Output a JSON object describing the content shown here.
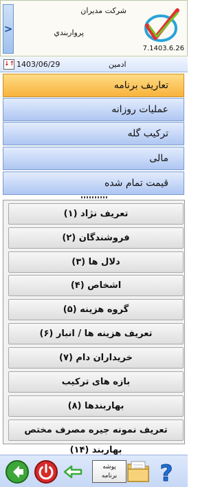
{
  "header": {
    "company": "شرکت مدیران",
    "product": "پرواربندي",
    "version": "7.1403.6.26",
    "back_glyph": ">"
  },
  "userbar": {
    "date": "1403/06/29",
    "user": "ادمین",
    "toggle_glyph": "↓↑"
  },
  "categories": [
    {
      "label": "تعاریف برنامه"
    },
    {
      "label": "عملیات روزانه"
    },
    {
      "label": "ترکیب گله"
    },
    {
      "label": "مالی"
    },
    {
      "label": "قیمت تمام شده"
    }
  ],
  "sub_items": [
    {
      "label": "تعریف نژاد (۱)"
    },
    {
      "label": "فروشندگان (۲)"
    },
    {
      "label": "دلال ها (۳)"
    },
    {
      "label": "اشخاص (۴)"
    },
    {
      "label": "گروه هزینه (۵)"
    },
    {
      "label": "تعریف هزینه ها / انبار (۶)"
    },
    {
      "label": "خریداران دام (۷)"
    },
    {
      "label": "بازه های ترکیب"
    },
    {
      "label": "بهاربندها (۸)"
    },
    {
      "label": "تعریف نمونه جیره مصرف مختص بهاربند (۱۴)"
    }
  ],
  "toolbar": {
    "folder_button_line1": "پوشه",
    "folder_button_line2": "برنامه",
    "help_glyph": "?",
    "icons": [
      "next-arrow-icon",
      "power-icon",
      "logout-arrow-icon",
      "folder-icon",
      "help-icon"
    ]
  },
  "colors": {
    "active_category": "#f8b33c",
    "category": "#aec6f2",
    "sub_item": "#e6e6e6",
    "toolbar": "#c6d8f6"
  }
}
